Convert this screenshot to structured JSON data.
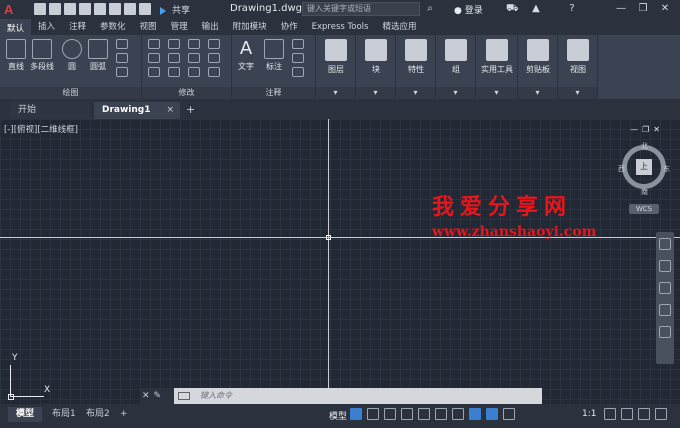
{
  "titlebar": {
    "logo": "A",
    "share_label": "共享",
    "doc_title": "Drawing1.dwg",
    "search_placeholder": "键入关键字或短语",
    "login_label": "登录",
    "help_label": "?"
  },
  "ribbon_tabs": [
    {
      "label": "默认",
      "active": true
    },
    {
      "label": "插入"
    },
    {
      "label": "注释"
    },
    {
      "label": "参数化"
    },
    {
      "label": "视图"
    },
    {
      "label": "管理"
    },
    {
      "label": "输出"
    },
    {
      "label": "附加模块"
    },
    {
      "label": "协作"
    },
    {
      "label": "Express Tools"
    },
    {
      "label": "精选应用"
    }
  ],
  "draw_panel": {
    "label": "绘图",
    "tools": [
      "直线",
      "多段线",
      "圆",
      "圆弧"
    ]
  },
  "modify_panel": {
    "label": "修改"
  },
  "annotation_panel": {
    "label": "注释",
    "tools": [
      "文字",
      "标注"
    ]
  },
  "big_panels": [
    "图层",
    "块",
    "特性",
    "组",
    "实用工具",
    "剪贴板",
    "视图"
  ],
  "doc_tabs": {
    "start": "开始",
    "drawing": "Drawing1",
    "close": "×",
    "add": "+"
  },
  "canvas": {
    "view_label": "[-][俯视][二维线框]",
    "compass": {
      "north": "北",
      "south": "南",
      "east": "东",
      "west": "西"
    },
    "viewcube_face": "上",
    "wcs": "WCS",
    "ucs_x": "X",
    "ucs_y": "Y"
  },
  "watermark": {
    "cn": "我爱分享网",
    "url": "www.zhanshaoyi.com"
  },
  "command": {
    "placeholder": "键入命令"
  },
  "layouts": [
    "模型",
    "布局1",
    "布局2"
  ],
  "status": {
    "model": "模型",
    "scale": "1:1"
  }
}
